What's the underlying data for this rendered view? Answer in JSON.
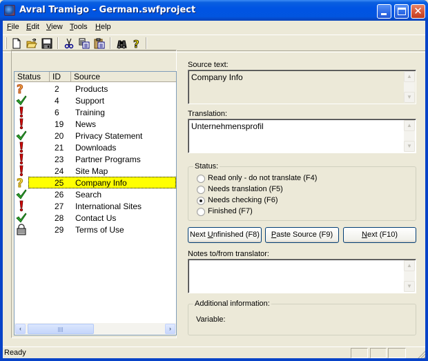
{
  "window": {
    "title": "Avral Tramigo - German.swfproject",
    "controls": {
      "minimize": "minimize",
      "maximize": "maximize",
      "close": "close"
    }
  },
  "menu": [
    {
      "label": "File",
      "accel": "F",
      "rest": "ile"
    },
    {
      "label": "Edit",
      "accel": "E",
      "rest": "dit"
    },
    {
      "label": "View",
      "accel": "V",
      "rest": "iew"
    },
    {
      "label": "Tools",
      "accel": "T",
      "rest": "ools"
    },
    {
      "label": "Help",
      "accel": "H",
      "rest": "elp"
    }
  ],
  "toolbar": [
    {
      "name": "new-icon",
      "tooltip": "New"
    },
    {
      "name": "open-icon",
      "tooltip": "Open"
    },
    {
      "name": "save-icon",
      "tooltip": "Save"
    },
    {
      "name": "cut-icon",
      "tooltip": "Cut"
    },
    {
      "name": "copy-icon",
      "tooltip": "Copy"
    },
    {
      "name": "paste-icon",
      "tooltip": "Paste"
    },
    {
      "name": "find-icon",
      "tooltip": "Find"
    },
    {
      "name": "help-icon",
      "tooltip": "Help"
    }
  ],
  "list": {
    "columns": {
      "status": "Status",
      "id": "ID",
      "source": "Source"
    },
    "rows": [
      {
        "status": "unknown",
        "id": "2",
        "source": "Products"
      },
      {
        "status": "finished",
        "id": "4",
        "source": "Support"
      },
      {
        "status": "needs-translation",
        "id": "6",
        "source": "Training"
      },
      {
        "status": "needs-translation",
        "id": "19",
        "source": "News"
      },
      {
        "status": "finished",
        "id": "20",
        "source": "Privacy Statement"
      },
      {
        "status": "needs-translation",
        "id": "21",
        "source": "Downloads"
      },
      {
        "status": "needs-translation",
        "id": "23",
        "source": "Partner Programs"
      },
      {
        "status": "needs-translation",
        "id": "24",
        "source": "Site Map"
      },
      {
        "status": "needs-checking",
        "id": "25",
        "source": "Company Info",
        "selected": true
      },
      {
        "status": "finished",
        "id": "26",
        "source": "Search"
      },
      {
        "status": "needs-translation",
        "id": "27",
        "source": "International Sites"
      },
      {
        "status": "finished",
        "id": "28",
        "source": "Contact Us"
      },
      {
        "status": "read-only",
        "id": "29",
        "source": "Terms of Use"
      }
    ],
    "selected_color": "#ffff00"
  },
  "editor": {
    "source_label": "Source text:",
    "source_value": "Company Info",
    "translation_label": "Translation:",
    "translation_value": "Unternehmensprofil",
    "status_group_label": "Status:",
    "status_options": [
      {
        "label": "Read only - do not translate (F4)",
        "checked": false
      },
      {
        "label": "Needs translation (F5)",
        "checked": false
      },
      {
        "label": "Needs checking (F6)",
        "checked": true
      },
      {
        "label": "Finished (F7)",
        "checked": false
      }
    ],
    "buttons": {
      "next_unfinished": {
        "pre": "Next ",
        "accel": "U",
        "post": "nfinished (F8)"
      },
      "paste_source": {
        "pre": "",
        "accel": "P",
        "post": "aste Source (F9)"
      },
      "next": {
        "pre": "",
        "accel": "N",
        "post": "ext (F10)"
      }
    },
    "notes_label": "Notes to/from translator:",
    "notes_value": "",
    "additional_label": "Additional information:",
    "variable_label": "Variable:",
    "variable_value": ""
  },
  "statusbar": {
    "text": "Ready",
    "panes": [
      "",
      "",
      ""
    ]
  },
  "colors": {
    "title_bar": "#0054e3",
    "face": "#ece9d8",
    "highlight": "#ffff00",
    "check": "#2e9e2e",
    "alert": "#d00000",
    "question_orange": "#e8a040",
    "question_yellow": "#f0d040"
  }
}
